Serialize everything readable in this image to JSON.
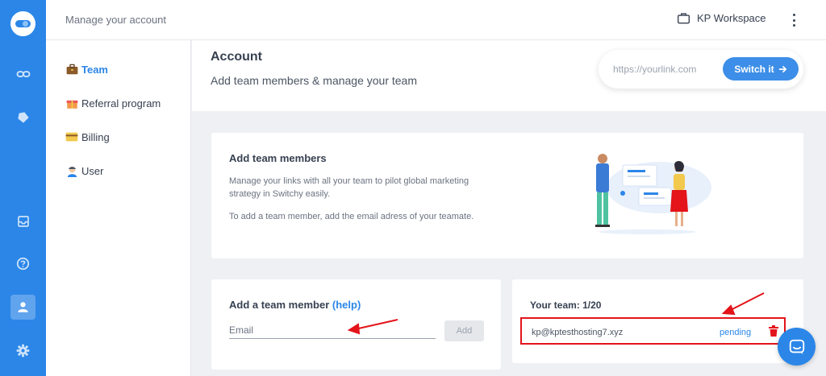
{
  "header": {
    "title": "Manage your account",
    "workspace_label": "KP Workspace"
  },
  "sidebar": {
    "items": [
      {
        "label": "Team",
        "icon": "briefcase-emoji",
        "active": true
      },
      {
        "label": "Referral program",
        "icon": "gift-emoji",
        "active": false
      },
      {
        "label": "Billing",
        "icon": "credit-card-emoji",
        "active": false
      },
      {
        "label": "User",
        "icon": "person-emoji",
        "active": false
      }
    ]
  },
  "rail": {
    "icons": [
      "logo-icon",
      "link-icon",
      "tag-icon",
      "inbox-icon",
      "help-icon",
      "user-icon",
      "settings-icon"
    ],
    "active": "user-icon"
  },
  "account": {
    "title": "Account",
    "subtitle": "Add team members & manage your team"
  },
  "switch": {
    "placeholder": "https://yourlink.com",
    "button_label": "Switch it"
  },
  "add_team": {
    "title": "Add team members",
    "desc1": "Manage your links with all your team to pilot global marketing strategy in Switchy easily.",
    "desc2": "To add a team member, add the email adress of your teamate."
  },
  "add_member": {
    "title": "Add a team member",
    "help_link": "(help)",
    "email_placeholder": "Email",
    "add_label": "Add"
  },
  "team": {
    "title": "Your team: 1/20",
    "members": [
      {
        "email": "kp@kptesthosting7.xyz",
        "status": "pending"
      }
    ]
  },
  "colors": {
    "brand": "#2b86e8",
    "annotation": "#e3141a",
    "delete": "#e3141a"
  }
}
